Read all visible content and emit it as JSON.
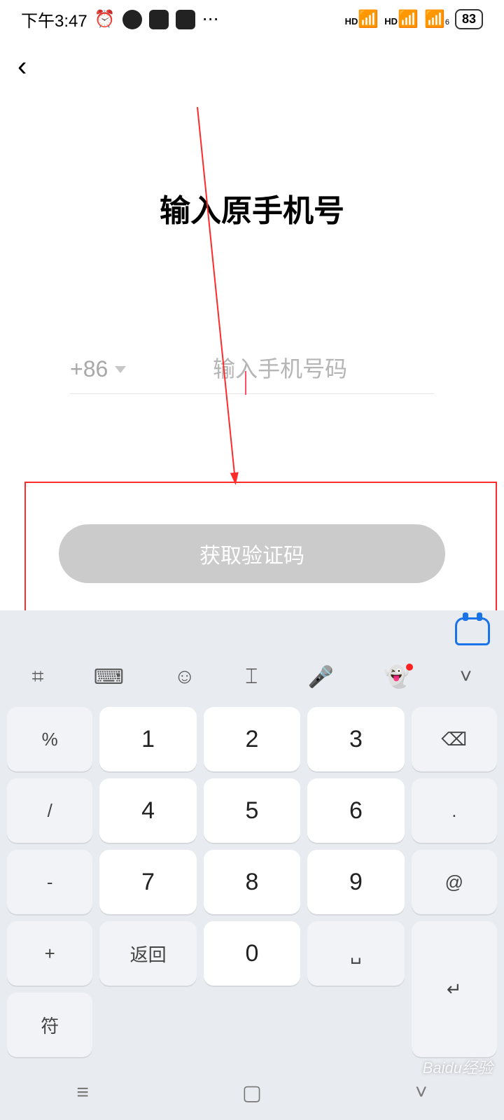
{
  "statusBar": {
    "time": "下午3:47",
    "batteryLevel": "83",
    "indicators": {
      "signal1": "HD",
      "signal2": "HD",
      "wifiSub": "6"
    }
  },
  "page": {
    "title": "输入原手机号",
    "countryCode": "+86",
    "phonePlaceholder": "输入手机号码",
    "phoneValue": "",
    "getCodeLabel": "获取验证码"
  },
  "keyboard": {
    "toolbar": [
      "⌗",
      "⌨",
      "☺",
      "⌶",
      "🎤",
      "👻",
      "˅"
    ],
    "leftCol": [
      "%",
      "/",
      "-",
      "+"
    ],
    "grid": [
      [
        "1",
        "2",
        "3"
      ],
      [
        "4",
        "5",
        "6"
      ],
      [
        "7",
        "8",
        "9"
      ]
    ],
    "bottomLeft": "符",
    "bottomMid": [
      "返回",
      "0",
      "␣"
    ],
    "rightCol": [
      "⌫",
      ".",
      "@",
      "↵"
    ]
  },
  "systemNav": {
    "left": "≡",
    "mid": "▢",
    "right": "˅"
  },
  "watermark": "Baidu经验"
}
